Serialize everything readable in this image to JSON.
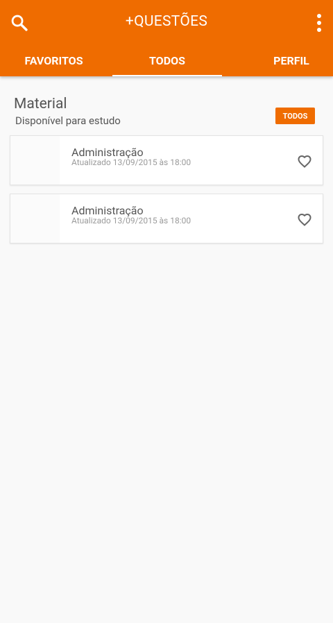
{
  "app": {
    "title": "+QUESTÕES"
  },
  "tabs": [
    {
      "label": "FAVORITOS"
    },
    {
      "label": "TODOS"
    },
    {
      "label": "PERFIL"
    }
  ],
  "section": {
    "title": "Material",
    "subtitle": "Disponível para estudo",
    "filter_label": "TODOS"
  },
  "items": [
    {
      "title": "Administração",
      "updated": "Atualizado 13/09/2015 às 18:00"
    },
    {
      "title": "Administração",
      "updated": "Atualizado 13/09/2015 às 18:00"
    }
  ],
  "colors": {
    "accent": "#ef6c00",
    "background": "#f9f9f9"
  }
}
